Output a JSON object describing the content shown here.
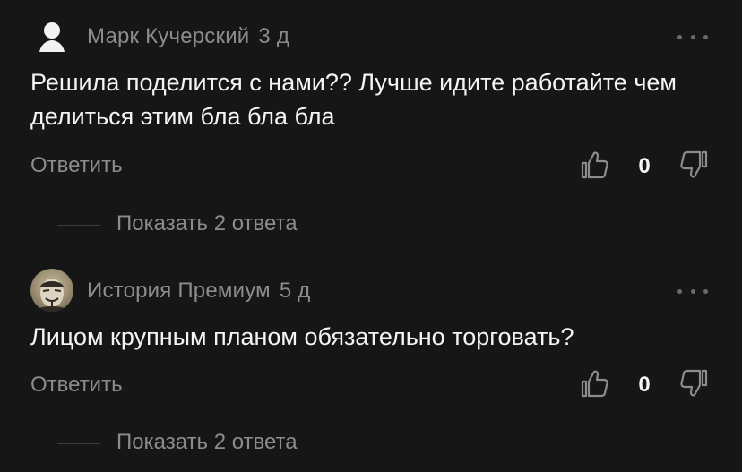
{
  "comments": [
    {
      "author": "Марк Кучерский",
      "time": "3 д",
      "avatar": "default-user-silhouette",
      "text": "Решила поделится с нами?? Лучше идите работайте чем делиться этим бла бла бла",
      "reply_label": "Ответить",
      "votes": "0",
      "show_replies_label": "Показать 2 ответа"
    },
    {
      "author": "История Премиум",
      "time": "5 д",
      "avatar": "mask-photo",
      "text": "Лицом крупным планом обязательно торговать?",
      "reply_label": "Ответить",
      "votes": "0",
      "show_replies_label": "Показать 2 ответа"
    }
  ],
  "icons": {
    "more": "more-dots-icon",
    "like": "thumbs-up-icon",
    "dislike": "thumbs-down-icon"
  },
  "colors": {
    "background": "#161616",
    "text_primary": "#f4f4f4",
    "text_secondary": "#8c8c8c"
  }
}
